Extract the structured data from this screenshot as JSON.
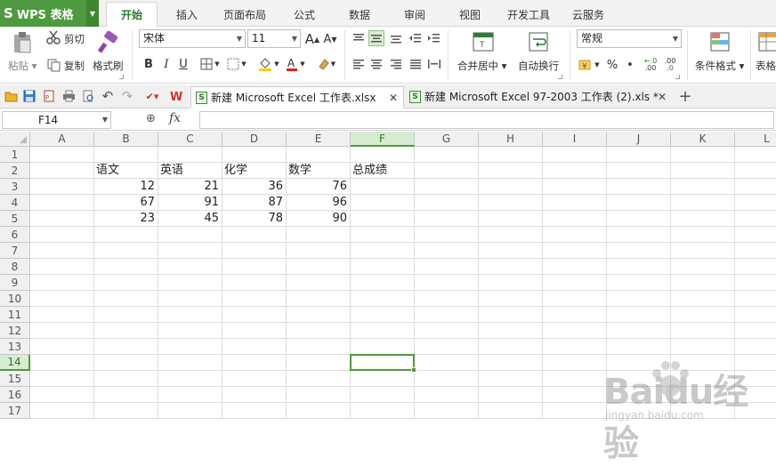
{
  "app": {
    "name": "WPS 表格",
    "logo": "S"
  },
  "menu_tabs": [
    "开始",
    "插入",
    "页面布局",
    "公式",
    "数据",
    "审阅",
    "视图",
    "开发工具",
    "云服务"
  ],
  "ribbon": {
    "paste": "粘贴",
    "cut": "剪切",
    "copy": "复制",
    "format_painter": "格式刷",
    "font_name": "宋体",
    "font_size": "11",
    "bold": "B",
    "italic": "I",
    "underline": "U",
    "merge_center": "合并居中",
    "wrap_text": "自动换行",
    "number_format": "常规",
    "percent": "%",
    "comma": "•",
    "inc_decimal": ".00",
    "dec_decimal": ".0",
    "conditional_format": "条件格式",
    "table_style": "表格"
  },
  "doc_tabs": [
    {
      "title": "新建 Microsoft Excel 工作表.xlsx",
      "active": true
    },
    {
      "title": "新建 Microsoft Excel 97-2003 工作表 (2).xls *",
      "active": false
    }
  ],
  "formula_bar": {
    "name_box": "F14",
    "fx": "fx",
    "value": ""
  },
  "sheet": {
    "columns": [
      "A",
      "B",
      "C",
      "D",
      "E",
      "F",
      "G",
      "H",
      "I",
      "J",
      "K",
      "L"
    ],
    "rows": [
      "1",
      "2",
      "3",
      "4",
      "5",
      "6",
      "7",
      "8",
      "9",
      "10",
      "11",
      "12",
      "13",
      "14",
      "15",
      "16",
      "17"
    ],
    "selected_cell": "F14",
    "cells": [
      {
        "ref": "B2",
        "value": "语文"
      },
      {
        "ref": "C2",
        "value": "英语"
      },
      {
        "ref": "D2",
        "value": "化学"
      },
      {
        "ref": "E2",
        "value": "数学"
      },
      {
        "ref": "F2",
        "value": "总成绩"
      },
      {
        "ref": "B3",
        "value": "12",
        "num": true
      },
      {
        "ref": "C3",
        "value": "21",
        "num": true
      },
      {
        "ref": "D3",
        "value": "36",
        "num": true
      },
      {
        "ref": "E3",
        "value": "76",
        "num": true
      },
      {
        "ref": "B4",
        "value": "67",
        "num": true
      },
      {
        "ref": "C4",
        "value": "91",
        "num": true
      },
      {
        "ref": "D4",
        "value": "87",
        "num": true
      },
      {
        "ref": "E4",
        "value": "96",
        "num": true
      },
      {
        "ref": "B5",
        "value": "23",
        "num": true
      },
      {
        "ref": "C5",
        "value": "45",
        "num": true
      },
      {
        "ref": "D5",
        "value": "78",
        "num": true
      },
      {
        "ref": "E5",
        "value": "90",
        "num": true
      }
    ]
  },
  "watermark": {
    "text": "Baidu经验",
    "url": "jingyan.baidu.com"
  },
  "colors": {
    "accent": "#4e9a3e",
    "selection_header": "#d7ecd1",
    "grid_line": "#dcdcdc"
  }
}
